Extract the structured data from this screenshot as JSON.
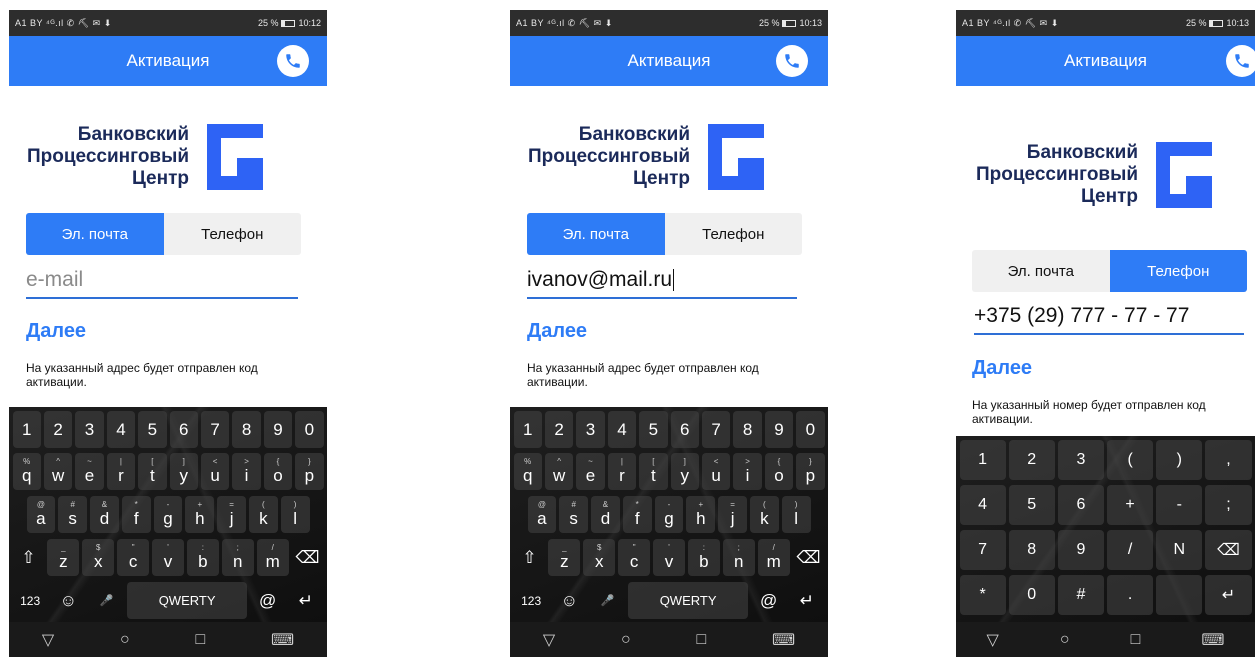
{
  "status": {
    "left": "A1 BY ⁴ᴳ.ıl ✆ ⛏ ✉ ⬇",
    "battery": "25 %",
    "times": [
      "10:12",
      "10:13",
      "10:13"
    ]
  },
  "appbar": {
    "title": "Активация"
  },
  "logo": {
    "line1": "Банковский",
    "line2": "Процессинговый",
    "line3": "Центр",
    "accent": "#2e63f5"
  },
  "tabs": {
    "email": "Эл. почта",
    "phone": "Телефон"
  },
  "screens": [
    {
      "field_placeholder": "e-mail",
      "field_value": "",
      "next": "Далее",
      "hint": "На указанный адрес будет отправлен код активации."
    },
    {
      "field_placeholder": "e-mail",
      "field_value": "ivanov@mail.ru",
      "next": "Далее",
      "hint": "На указанный адрес будет отправлен код активации."
    },
    {
      "field_placeholder": "",
      "field_value": "+375 (29) 777 - 77 - 77",
      "next": "Далее",
      "hint": "На указанный номер будет отправлен код активации."
    }
  ],
  "keyboard": {
    "numbers": [
      "1",
      "2",
      "3",
      "4",
      "5",
      "6",
      "7",
      "8",
      "9",
      "0"
    ],
    "row1": [
      [
        "q",
        "%"
      ],
      [
        "w",
        "^"
      ],
      [
        "e",
        "~"
      ],
      [
        "r",
        "|"
      ],
      [
        "t",
        "["
      ],
      [
        "y",
        "]"
      ],
      [
        "u",
        "<"
      ],
      [
        "i",
        ">"
      ],
      [
        "o",
        "{"
      ],
      [
        "p",
        "}"
      ]
    ],
    "row2": [
      [
        "a",
        "@"
      ],
      [
        "s",
        "#"
      ],
      [
        "d",
        "&"
      ],
      [
        "f",
        "*"
      ],
      [
        "g",
        "-"
      ],
      [
        "h",
        "+"
      ],
      [
        "j",
        "="
      ],
      [
        "k",
        "("
      ],
      [
        "l",
        ")"
      ]
    ],
    "row3": [
      [
        "z",
        "_"
      ],
      [
        "x",
        "$"
      ],
      [
        "c",
        "\""
      ],
      [
        "v",
        "'"
      ],
      [
        "b",
        ":"
      ],
      [
        "n",
        ";"
      ],
      [
        "m",
        "/"
      ]
    ],
    "sym_label": "123",
    "space_label": "QWERTY",
    "period_label": ".",
    "at_label": "@",
    "shift": "⇧",
    "backspace": "⌫",
    "enter": "↵",
    "emoji": "☺",
    "mic": "🎤"
  },
  "numpad": {
    "row1": [
      "1",
      "2",
      "3",
      "(",
      ")",
      ","
    ],
    "row2": [
      "4",
      "5",
      "6",
      "+",
      "-",
      ";"
    ],
    "row3": [
      "7",
      "8",
      "9",
      "/",
      "N",
      "⌫"
    ],
    "row4": [
      "*",
      "0",
      "#",
      ".",
      "",
      "↵"
    ]
  },
  "navbar": {
    "back": "▽",
    "home": "○",
    "recents": "□",
    "keyboard": "⌨"
  },
  "colors": {
    "primary": "#2e7cf6",
    "logo_text": "#1b2a5a"
  }
}
